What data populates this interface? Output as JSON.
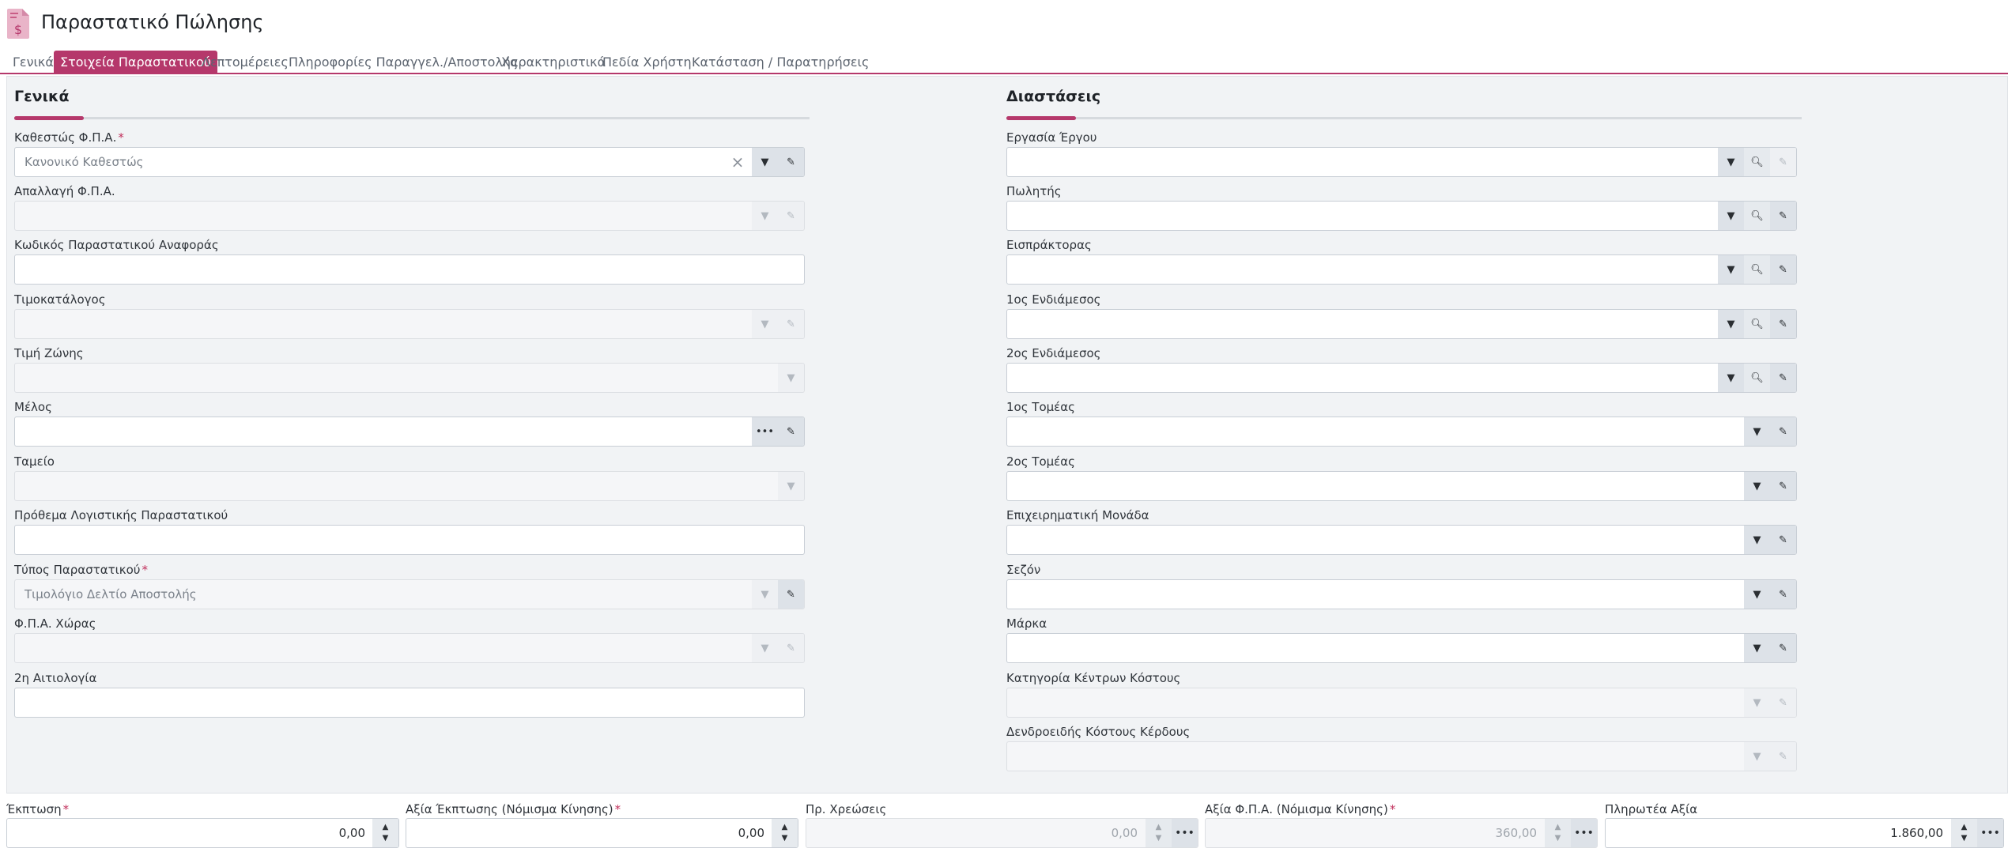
{
  "page": {
    "title": "Παραστατικό Πώλησης",
    "icon": "invoice-document-icon",
    "accent_color": "#b5386b"
  },
  "tabs": [
    {
      "label": "Γενικά"
    },
    {
      "label": "Στοιχεία Παραστατικού",
      "active": true
    },
    {
      "label": "Λεπτομέρειες"
    },
    {
      "label": "Πληροφορίες Παραγγελ./Αποστολής"
    },
    {
      "label": "Χαρακτηριστικά"
    },
    {
      "label": "Πεδία Χρήστη"
    },
    {
      "label": "Κατάσταση / Παρατηρήσεις"
    }
  ],
  "general": {
    "title": "Γενικά",
    "fields": [
      {
        "label": "Καθεστώς Φ.Π.Α.",
        "required": true,
        "value": "Κανονικό Καθεστώς"
      },
      {
        "label": "Απαλλαγή Φ.Π.Α.",
        "value": ""
      },
      {
        "label": "Κωδικός Παραστατικού Αναφοράς",
        "value": ""
      },
      {
        "label": "Τιμοκατάλογος",
        "value": ""
      },
      {
        "label": "Τιμή Ζώνης",
        "value": ""
      },
      {
        "label": "Μέλος",
        "value": ""
      },
      {
        "label": "Ταμείο",
        "value": ""
      },
      {
        "label": "Πρόθεμα Λογιστικής Παραστατικού",
        "value": ""
      },
      {
        "label": "Τύπος Παραστατικού",
        "required": true,
        "value": "Τιμολόγιο Δελτίο Αποστολής"
      },
      {
        "label": "Φ.Π.Α. Χώρας",
        "value": ""
      },
      {
        "label": "2η Αιτιολογία",
        "value": ""
      }
    ]
  },
  "dimensions": {
    "title": "Διαστάσεις",
    "fields": [
      {
        "label": "Εργασία Έργου",
        "value": ""
      },
      {
        "label": "Πωλητής",
        "value": ""
      },
      {
        "label": "Εισπράκτορας",
        "value": ""
      },
      {
        "label": "1ος Ενδιάμεσος",
        "value": ""
      },
      {
        "label": "2ος Ενδιάμεσος",
        "value": ""
      },
      {
        "label": "1ος Τομέας",
        "value": ""
      },
      {
        "label": "2ος Τομέας",
        "value": ""
      },
      {
        "label": "Επιχειρηματική Μονάδα",
        "value": ""
      },
      {
        "label": "Σεζόν",
        "value": ""
      },
      {
        "label": "Μάρκα",
        "value": ""
      },
      {
        "label": "Κατηγορία Κέντρων Κόστους",
        "value": ""
      },
      {
        "label": "Δενδροειδής Κόστους Κέρδους",
        "value": ""
      }
    ]
  },
  "totals": [
    {
      "label": "Έκπτωση",
      "required": true,
      "value": "0,00"
    },
    {
      "label": "Αξία Έκπτωσης (Νόμισμα Κίνησης)",
      "required": true,
      "value": "0,00"
    },
    {
      "label": "Πρ. Χρεώσεις",
      "value": "0,00"
    },
    {
      "label": "Αξία Φ.Π.Α. (Νόμισμα Κίνησης)",
      "required": true,
      "value": "360,00"
    },
    {
      "label": "Πληρωτέα Αξία",
      "value": "1.860,00"
    }
  ],
  "required_marker": "*",
  "icons": {
    "dropdown": "chevron-down-icon",
    "edit": "pencil-icon",
    "search": "magnifier-icon",
    "more": "ellipsis-icon",
    "clear": "close-icon",
    "spin_up": "caret-up-icon",
    "spin_down": "caret-down-icon"
  }
}
